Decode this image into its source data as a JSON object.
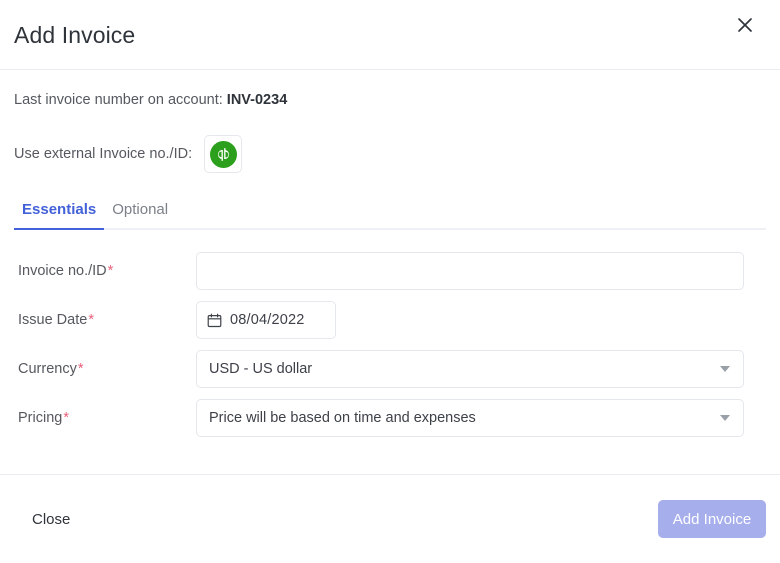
{
  "dialog": {
    "title": "Add Invoice",
    "close_icon": "close-icon"
  },
  "meta": {
    "last_invoice_label": "Last invoice number on account:",
    "last_invoice_value": "INV-0234"
  },
  "external": {
    "label": "Use external Invoice no./ID:",
    "provider": "quickbooks-icon",
    "provider_mark": "qb",
    "provider_color": "#2ca01c"
  },
  "tabs": [
    {
      "label": "Essentials",
      "active": true
    },
    {
      "label": "Optional",
      "active": false
    }
  ],
  "form": {
    "required_marker": "*",
    "fields": [
      {
        "label": "Invoice no./ID",
        "required": true,
        "type": "text",
        "value": "",
        "placeholder": ""
      },
      {
        "label": "Issue Date",
        "required": true,
        "type": "date",
        "value": "08/04/2022",
        "icon": "calendar-icon"
      },
      {
        "label": "Currency",
        "required": true,
        "type": "select",
        "value": "USD - US dollar"
      },
      {
        "label": "Pricing",
        "required": true,
        "type": "select",
        "value": "Price will be based on time and expenses"
      }
    ]
  },
  "footer": {
    "close_label": "Close",
    "submit_label": "Add Invoice",
    "submit_color": "#a6aeec"
  },
  "colors": {
    "accent": "#4361d8",
    "required": "#e8607a",
    "border": "#e4e7eb",
    "text": "#3d4148",
    "muted": "#7b8089"
  }
}
